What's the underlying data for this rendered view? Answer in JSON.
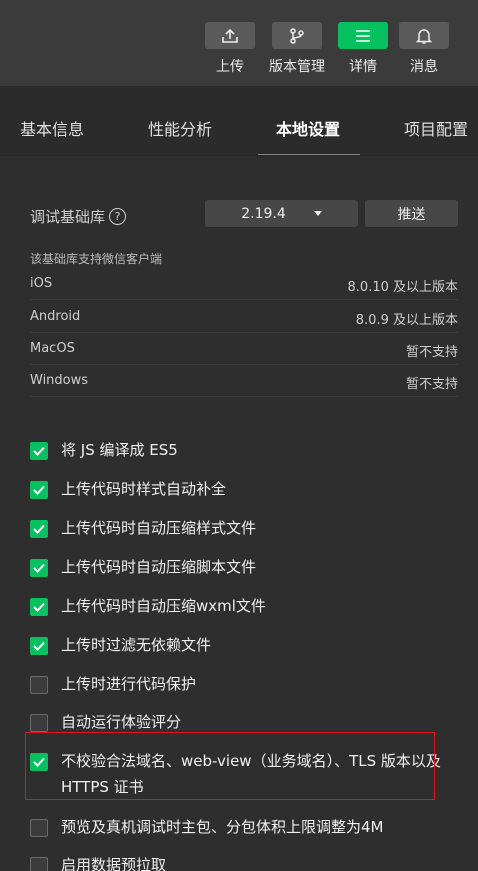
{
  "toolbar": {
    "buttons": [
      {
        "label": "上传",
        "icon": "upload-icon"
      },
      {
        "label": "版本管理",
        "icon": "branch-icon"
      },
      {
        "label": "详情",
        "icon": "menu-icon",
        "active": true
      },
      {
        "label": "消息",
        "icon": "bell-icon"
      }
    ]
  },
  "tabs": [
    {
      "label": "基本信息"
    },
    {
      "label": "性能分析"
    },
    {
      "label": "本地设置",
      "active": true
    },
    {
      "label": "项目配置"
    }
  ],
  "library": {
    "label": "调试基础库",
    "help": "?",
    "version": "2.19.4",
    "push_label": "推送"
  },
  "support": {
    "note": "该基础库支持微信客户端",
    "clients": [
      {
        "name": "iOS",
        "version": "8.0.10 及以上版本"
      },
      {
        "name": "Android",
        "version": "8.0.9 及以上版本"
      },
      {
        "name": "MacOS",
        "version": "暂不支持"
      },
      {
        "name": "Windows",
        "version": "暂不支持"
      }
    ]
  },
  "options": [
    {
      "label": "将 JS 编译成 ES5",
      "checked": true
    },
    {
      "label": "上传代码时样式自动补全",
      "checked": true
    },
    {
      "label": "上传代码时自动压缩样式文件",
      "checked": true
    },
    {
      "label": "上传代码时自动压缩脚本文件",
      "checked": true
    },
    {
      "label": "上传代码时自动压缩wxml文件",
      "checked": true
    },
    {
      "label": "上传时过滤无依赖文件",
      "checked": true
    },
    {
      "label": "上传时进行代码保护",
      "checked": false
    },
    {
      "label": "自动运行体验评分",
      "checked": false
    },
    {
      "label": "不校验合法域名、web-view（业务域名）、TLS 版本以及 HTTPS 证书",
      "checked": true
    },
    {
      "label": "预览及真机调试时主包、分包体积上限调整为4M",
      "checked": false
    },
    {
      "label": "启用数据预拉取",
      "checked": false
    }
  ],
  "colors": {
    "accent": "#07c160",
    "highlight": "#e0141e"
  }
}
